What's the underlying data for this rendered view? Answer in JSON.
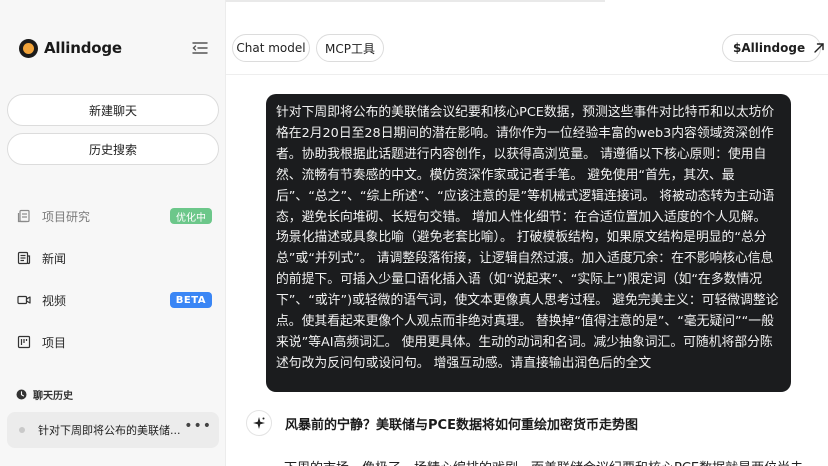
{
  "sidebar": {
    "brand": "Allindoge",
    "new_chat": "新建聊天",
    "history_search": "历史搜索",
    "nav": [
      {
        "label": "项目研究",
        "badge": "优化中"
      },
      {
        "label": "新闻"
      },
      {
        "label": "视频",
        "badge": "BETA"
      },
      {
        "label": "项目"
      }
    ],
    "chat_history_header": "聊天历史",
    "history_items": [
      "针对下周即将公布的美联储..."
    ]
  },
  "topbar": {
    "tabs": [
      "Chat model",
      "MCP工具"
    ],
    "token_label": "$Allindoge"
  },
  "chat": {
    "user_message": "针对下周即将公布的美联储会议纪要和核心PCE数据，预测这些事件对比特币和以太坊价格在2月20日至28日期间的潜在影响。请你作为一位经验丰富的web3内容领域资深创作者。协助我根据此话题进行内容创作，以获得高浏览量。 请遵循以下核心原则：使用自然、流畅有节奏感的中文。模仿资深作家或记者手笔。 避免使用“首先，其次、最后”、“总之”、“综上所述”、“应该注意的是”等机械式逻辑连接词。 将被动态转为主动语态，避免长向堆砌、长短句交错。 增加人性化细节：在合适位置加入适度的个人见解。 场景化描述或具象比喻（避免老套比喻）。 打破模板结构，如果原文结构是明显的“总分总”或“并列式”。 请调整段落衔接，让逻辑自然过渡。加入适度冗余：在不影响核心信息的前提下。可插入少量口语化插入语（如“说起来”、“实际上”)限定词（如“在多数情况下”、“或许”)或轻微的语气词，使文本更像真人思考过程。 避免完美主义：可轻微调整论点。使其看起来更像个人观点而非绝对真理。 替换掉“值得注意的是”、“毫无疑问”“一般来说”等AI高频词汇。 使用更具体。生动的动词和名词。减少抽象词汇。可随机将部分陈述句改为反问句或设问句。 增强互动感。请直接输出润色后的全文",
    "reply_title": "风暴前的宁静？美联储与PCE数据将如何重绘加密货币走势图",
    "reply_body": "下周的市场，像极了一场精心编排的戏剧。而美联储会议纪要和核心PCE数据就是两位尚未"
  },
  "colors": {
    "badge_green": "#6cc78a",
    "badge_blue": "#3a86f5",
    "bubble_bg": "#1b1c1e"
  }
}
